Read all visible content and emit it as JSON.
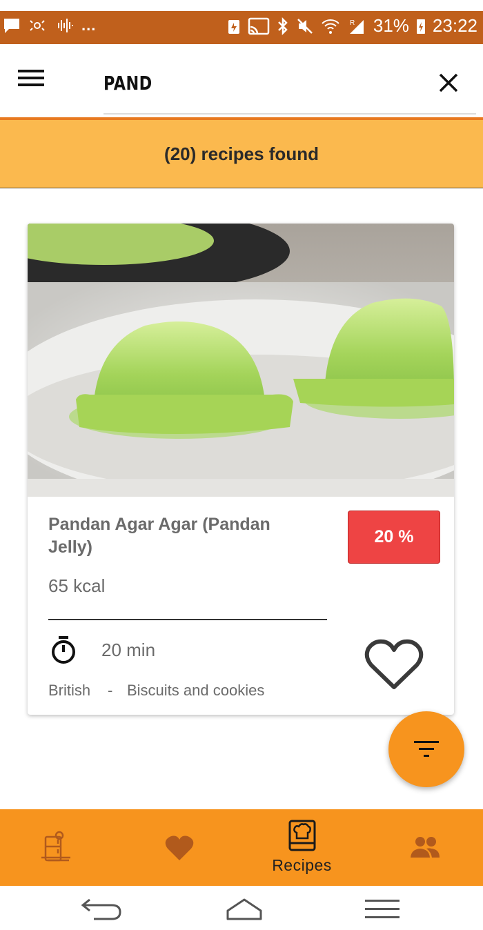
{
  "status_bar": {
    "left_icons": [
      "message-icon",
      "signal-wave-icon",
      "voice-icon"
    ],
    "overflow": "...",
    "battery_percent": "31%",
    "time": "23:22",
    "roaming": "R"
  },
  "app_bar": {
    "search_value": "PAND"
  },
  "results": {
    "text": "(20) recipes found"
  },
  "recipe": {
    "title": "Pandan Agar Agar (Pandan Jelly)",
    "match": "20 %",
    "calories": "65 kcal",
    "time": "20 min",
    "cuisine": "British",
    "separator": "-",
    "category": "Biscuits and cookies"
  },
  "bottom_nav": {
    "items": [
      {
        "icon": "fridge-ingredients-icon",
        "label": ""
      },
      {
        "icon": "heart-icon",
        "label": ""
      },
      {
        "icon": "recipe-book-icon",
        "label": "Recipes"
      },
      {
        "icon": "people-icon",
        "label": ""
      }
    ]
  },
  "colors": {
    "status": "#c0601c",
    "accent": "#f7941e",
    "banner": "#fbb94e",
    "badge": "#ee4444"
  }
}
